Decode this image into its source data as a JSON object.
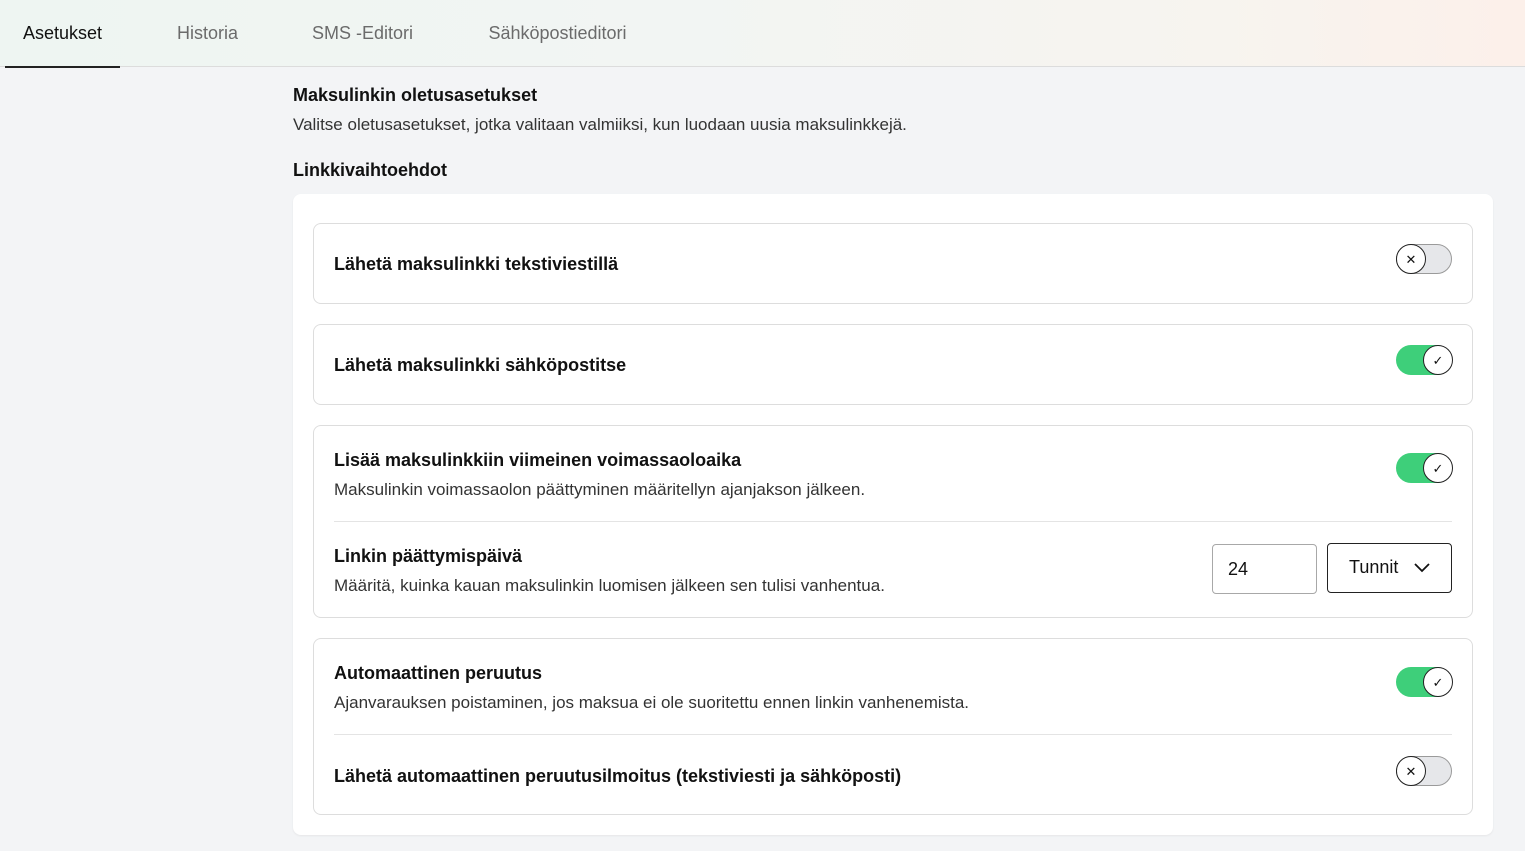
{
  "tabs": [
    {
      "label": "Asetukset",
      "active": true
    },
    {
      "label": "Historia",
      "active": false
    },
    {
      "label": "SMS -Editori",
      "active": false
    },
    {
      "label": "Sähköpostieditori",
      "active": false
    }
  ],
  "header": {
    "title": "Maksulinkin oletusasetukset",
    "description": "Valitse oletusasetukset, jotka valitaan valmiiksi, kun luodaan uusia maksulinkkejä."
  },
  "section": {
    "title": "Linkkivaihtoehdot"
  },
  "options": {
    "sms": {
      "title": "Lähetä maksulinkki tekstiviestillä",
      "enabled": false
    },
    "email": {
      "title": "Lähetä maksulinkki sähköpostitse",
      "enabled": true
    },
    "expiry": {
      "title": "Lisää maksulinkkiin viimeinen voimassaoloaika",
      "description": "Maksulinkin voimassaolon päättyminen määritellyn ajanjakson jälkeen.",
      "enabled": true
    },
    "expiry_date": {
      "title": "Linkin päättymispäivä",
      "description": "Määritä, kuinka kauan maksulinkin luomisen jälkeen sen tulisi vanhentua.",
      "amount": "24",
      "unit": "Tunnit"
    },
    "auto_cancel": {
      "title": "Automaattinen peruutus",
      "description": "Ajanvarauksen poistaminen, jos maksua ei ole suoritettu ennen linkin vanhenemista.",
      "enabled": true
    },
    "cancel_notice": {
      "title": "Lähetä automaattinen peruutusilmoitus (tekstiviesti ja sähköposti)",
      "enabled": false
    }
  },
  "icons": {
    "toggle_on": "check-icon",
    "toggle_off": "x-icon",
    "dropdown": "chevron-down-icon"
  },
  "colors": {
    "toggle_on": "#3ecf7a",
    "toggle_off": "#e6e7ea"
  }
}
